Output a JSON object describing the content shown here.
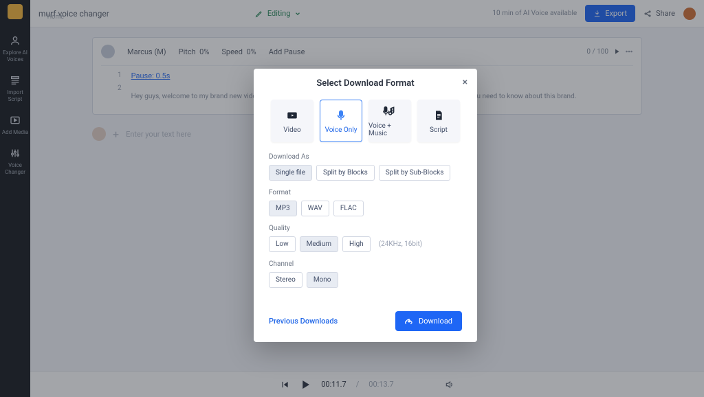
{
  "header": {
    "title": "murf voice changer",
    "home": "Home",
    "center_status": "Editing",
    "credits": "10 min of AI Voice available",
    "export_label": "Export",
    "share_label": "Share"
  },
  "rail": {
    "items": [
      {
        "label": "Explore AI Voices"
      },
      {
        "label": "Import Script"
      },
      {
        "label": "Add Media"
      },
      {
        "label": "Voice Changer"
      }
    ]
  },
  "block": {
    "voice_name": "Marcus (M)",
    "pitch_label": "Pitch",
    "pitch_value": "0%",
    "speed_label": "Speed",
    "speed_value": "0%",
    "pause_label": "Add Pause",
    "counter": "0 / 100",
    "sub_duration": "Pause: 0.5s",
    "script_text": "Hey guys, welcome to my brand new video here on. Today we have a really interesting video to show everything you need to know about this brand.",
    "add_placeholder": "Enter your text here"
  },
  "player": {
    "current": "00:11.7",
    "duration": "00:13.7"
  },
  "modal": {
    "title": "Select Download Format",
    "formats": [
      {
        "label": "Video"
      },
      {
        "label": "Voice Only"
      },
      {
        "label": "Voice + Music"
      },
      {
        "label": "Script"
      }
    ],
    "selected_format_index": 1,
    "download_as": {
      "label": "Download As",
      "options": [
        "Single file",
        "Split by Blocks",
        "Split by Sub-Blocks"
      ],
      "selected_index": 0
    },
    "file_format": {
      "label": "Format",
      "options": [
        "MP3",
        "WAV",
        "FLAC"
      ],
      "selected_index": 0
    },
    "quality": {
      "label": "Quality",
      "options": [
        "Low",
        "Medium",
        "High"
      ],
      "selected_index": 1,
      "hint": "(24KHz, 16bit)"
    },
    "channel": {
      "label": "Channel",
      "options": [
        "Stereo",
        "Mono"
      ],
      "selected_index": 1
    },
    "previous_label": "Previous Downloads",
    "download_label": "Download"
  }
}
